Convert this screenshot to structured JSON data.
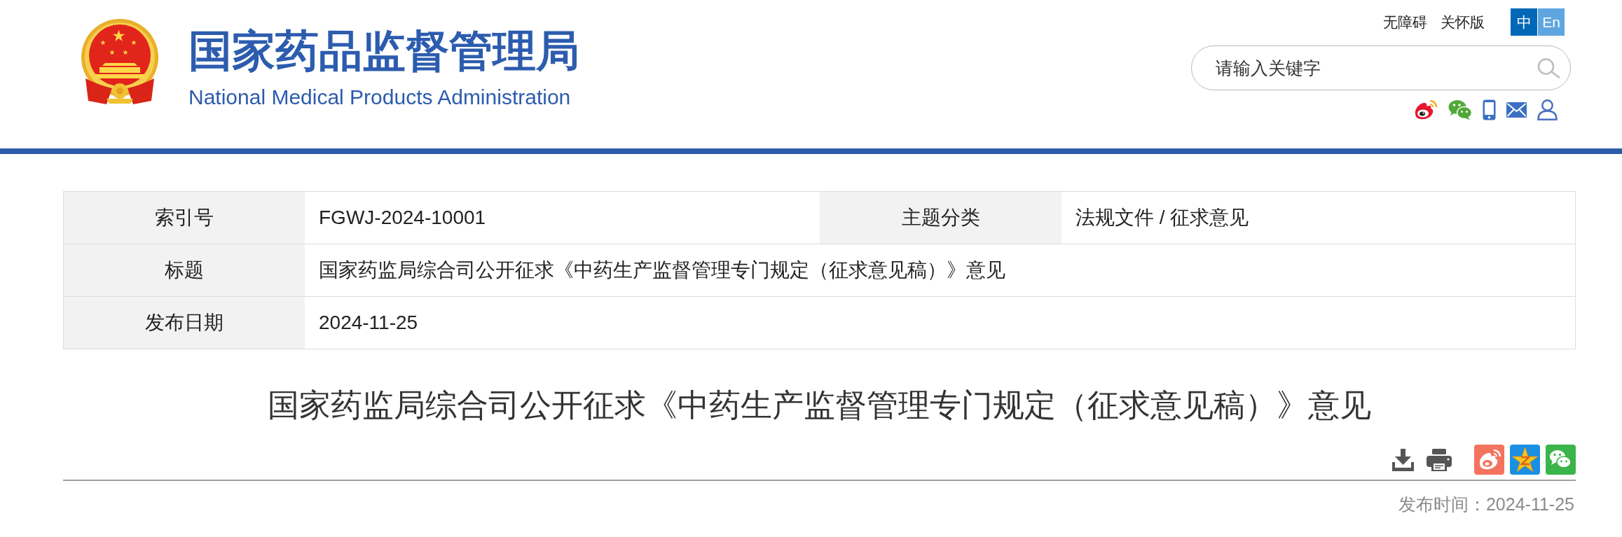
{
  "header": {
    "title": "国家药品监督管理局",
    "subtitle": "National Medical Products Administration",
    "links": [
      "无障碍",
      "关怀版"
    ],
    "languages": [
      {
        "label": "中",
        "selected": true
      },
      {
        "label": "En",
        "selected": false
      }
    ],
    "search": {
      "placeholder": "请输入关键字"
    }
  },
  "info_table": {
    "rows": [
      {
        "cells": [
          {
            "label": "索引号",
            "value": "FGWJ-2024-10001"
          },
          {
            "label": "主题分类",
            "value": "法规文件 / 征求意见"
          }
        ]
      },
      {
        "cells": [
          {
            "label": "标题",
            "value": "国家药监局综合司公开征求《中药生产监督管理专门规定（征求意见稿）》意见"
          }
        ]
      },
      {
        "cells": [
          {
            "label": "发布日期",
            "value": "2024-11-25"
          }
        ]
      }
    ]
  },
  "article": {
    "title": "国家药监局综合司公开征求《中药生产监督管理专门规定（征求意见稿）》意见",
    "publish_time": "发布时间：2024-11-25"
  }
}
